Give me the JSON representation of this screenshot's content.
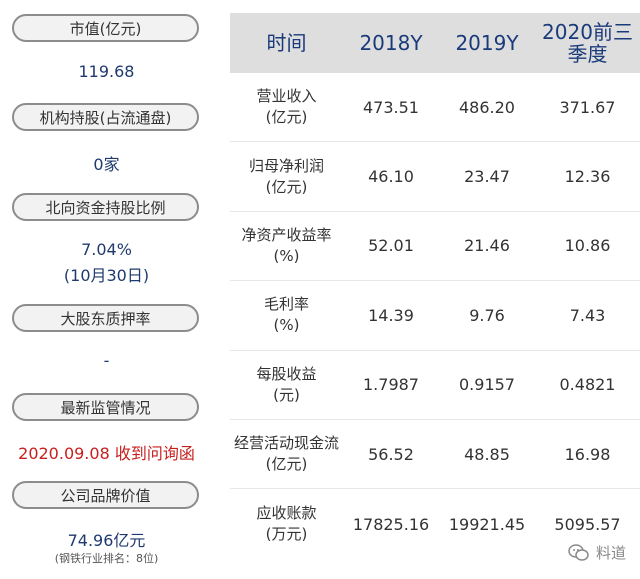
{
  "left": {
    "items": [
      {
        "label": "市值(亿元)",
        "value": "119.68"
      },
      {
        "label": "机构持股(占流通盘)",
        "value": "0家"
      },
      {
        "label": "北向资金持股比例",
        "value": "7.04%",
        "value2": "(10月30日)"
      },
      {
        "label": "大股东质押率",
        "value": "-"
      },
      {
        "label": "最新监管情况",
        "value": "2020.09.08 收到问询函",
        "value_color": "#c81e1e"
      },
      {
        "label": "公司品牌价值",
        "value": "74.96亿元",
        "note": "(钢铁行业排名：8位)"
      }
    ]
  },
  "table": {
    "headers": [
      "时间",
      "2018Y",
      "2019Y",
      "2020前三季度"
    ],
    "rows": [
      {
        "label1": "营业收入",
        "label2": "(亿元)",
        "values": [
          "473.51",
          "486.20",
          "371.67"
        ]
      },
      {
        "label1": "归母净利润",
        "label2": "(亿元)",
        "values": [
          "46.10",
          "23.47",
          "12.36"
        ]
      },
      {
        "label1": "净资产收益率",
        "label2": "(%)",
        "values": [
          "52.01",
          "21.46",
          "10.86"
        ]
      },
      {
        "label1": "毛利率",
        "label2": "(%)",
        "values": [
          "14.39",
          "9.76",
          "7.43"
        ]
      },
      {
        "label1": "每股收益",
        "label2": "(元)",
        "values": [
          "1.7987",
          "0.9157",
          "0.4821"
        ]
      },
      {
        "label1": "经营活动现金流",
        "label2": "(亿元)",
        "values": [
          "56.52",
          "48.85",
          "16.98"
        ]
      },
      {
        "label1": "应收账款",
        "label2": "(万元)",
        "values": [
          "17825.16",
          "19921.45",
          "5095.57"
        ]
      }
    ]
  },
  "watermark": {
    "text": "料道",
    "icon": "wechat-icon"
  }
}
